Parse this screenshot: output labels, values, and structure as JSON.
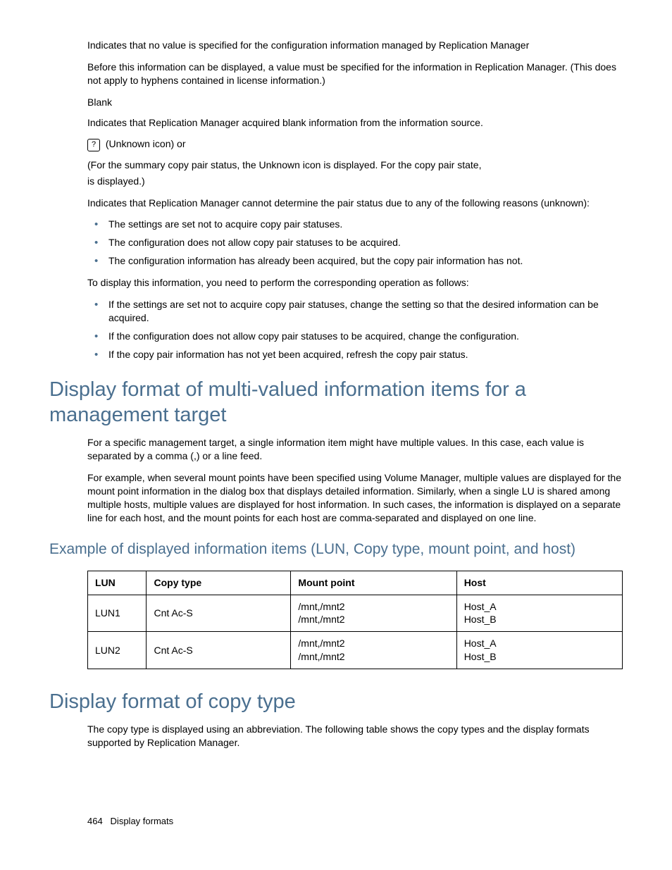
{
  "intro": {
    "p1": "Indicates that no value is specified for the configuration information managed by Replication Manager",
    "p2": "Before this information can be displayed, a value must be specified for the information in Replication Manager. (This does not apply to hyphens contained in license information.)",
    "blank_label": "Blank",
    "p3": "Indicates that Replication Manager acquired blank information from the information source.",
    "unknown_icon_glyph": "?",
    "unknown_label": " (Unknown icon) or",
    "p4_line1": "(For the summary copy pair status, the Unknown icon is displayed. For the copy pair state,",
    "p4_line2": "is displayed.)",
    "p5": "Indicates that Replication Manager cannot determine the pair status due to any of the following reasons (unknown):",
    "reasons": [
      "The settings are set not to acquire copy pair statuses.",
      "The configuration does not allow copy pair statuses to be acquired.",
      "The configuration information has already been acquired, but the copy pair information has not."
    ],
    "p6": "To display this information, you need to perform the corresponding operation as follows:",
    "ops": [
      "If the settings are set not to acquire copy pair statuses, change the setting so that the desired information can be acquired.",
      "If the configuration does not allow copy pair statuses to be acquired, change the configuration.",
      "If the copy pair information has not yet been acquired, refresh the copy pair status."
    ]
  },
  "section_multi": {
    "heading": "Display format of multi-valued information items for a management target",
    "p1": "For a specific management target, a single information item might have multiple values. In this case, each value is separated by a comma (,) or a line feed.",
    "p2": "For example, when several mount points have been specified using Volume Manager, multiple values are displayed for the mount point information in the dialog box that displays detailed information. Similarly, when a single LU is shared among multiple hosts, multiple values are displayed for host information. In such cases, the information is displayed on a separate line for each host, and the mount points for each host are comma-separated and displayed on one line.",
    "subheading": "Example of displayed information items (LUN, Copy type, mount point, and host)",
    "table": {
      "headers": [
        "LUN",
        "Copy type",
        "Mount point",
        "Host"
      ],
      "rows": [
        {
          "lun": "LUN1",
          "copy_type": "Cnt Ac-S",
          "mount_l1": "/mnt,/mnt2",
          "mount_l2": "/mnt,/mnt2",
          "host_l1": "Host_A",
          "host_l2": "Host_B"
        },
        {
          "lun": "LUN2",
          "copy_type": "Cnt Ac-S",
          "mount_l1": "/mnt,/mnt2",
          "mount_l2": "/mnt,/mnt2",
          "host_l1": "Host_A",
          "host_l2": "Host_B"
        }
      ]
    }
  },
  "section_copytype": {
    "heading": "Display format of copy type",
    "p1": "The copy type is displayed using an abbreviation. The following table shows the copy types and the display formats supported by Replication Manager."
  },
  "footer": {
    "page_number": "464",
    "chapter": "Display formats"
  }
}
